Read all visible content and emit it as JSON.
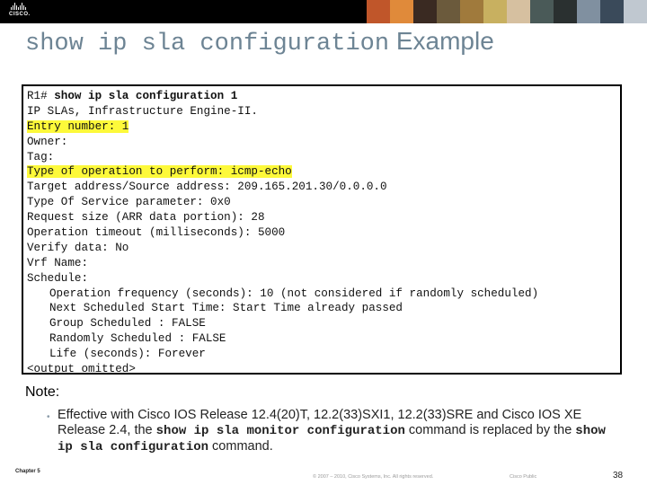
{
  "header": {
    "logo_text": "CISCO.",
    "photo_strip_colors": [
      "#c0562a",
      "#e08a3a",
      "#3a2a22",
      "#6b5a3c",
      "#a07a3c",
      "#c8b060",
      "#d6c0a0",
      "#4a5a58",
      "#2a3030",
      "#8090a0",
      "#3a4a5a",
      "#c0c8d0"
    ]
  },
  "title": {
    "mono_part": "show ip sla configuration",
    "sans_part": " Example",
    "color": "#6d8494"
  },
  "code": {
    "lines": [
      {
        "prompt": "R1# ",
        "cmd": "show ip sla configuration 1",
        "text": "",
        "highlight": false,
        "indent": false
      },
      {
        "prompt": "",
        "cmd": "",
        "text": "IP SLAs, Infrastructure Engine-II.",
        "highlight": false,
        "indent": false
      },
      {
        "prompt": "",
        "cmd": "",
        "text": "Entry number: 1",
        "highlight": true,
        "indent": false
      },
      {
        "prompt": "",
        "cmd": "",
        "text": "Owner:",
        "highlight": false,
        "indent": false
      },
      {
        "prompt": "",
        "cmd": "",
        "text": "Tag:",
        "highlight": false,
        "indent": false
      },
      {
        "prompt": "",
        "cmd": "",
        "text": "Type of operation to perform: icmp-echo",
        "highlight": true,
        "indent": false
      },
      {
        "prompt": "",
        "cmd": "",
        "text": "Target address/Source address: 209.165.201.30/0.0.0.0",
        "highlight": false,
        "indent": false
      },
      {
        "prompt": "",
        "cmd": "",
        "text": "Type Of Service parameter: 0x0",
        "highlight": false,
        "indent": false
      },
      {
        "prompt": "",
        "cmd": "",
        "text": "Request size (ARR data portion): 28",
        "highlight": false,
        "indent": false
      },
      {
        "prompt": "",
        "cmd": "",
        "text": "Operation timeout (milliseconds): 5000",
        "highlight": false,
        "indent": false
      },
      {
        "prompt": "",
        "cmd": "",
        "text": "Verify data: No",
        "highlight": false,
        "indent": false
      },
      {
        "prompt": "",
        "cmd": "",
        "text": "Vrf Name:",
        "highlight": false,
        "indent": false
      },
      {
        "prompt": "",
        "cmd": "",
        "text": "Schedule:",
        "highlight": false,
        "indent": false
      },
      {
        "prompt": "",
        "cmd": "",
        "text": "Operation frequency (seconds): 10 (not considered if randomly scheduled)",
        "highlight": false,
        "indent": true
      },
      {
        "prompt": "",
        "cmd": "",
        "text": "Next Scheduled Start Time: Start Time already passed",
        "highlight": false,
        "indent": true
      },
      {
        "prompt": "",
        "cmd": "",
        "text": "Group Scheduled : FALSE",
        "highlight": false,
        "indent": true
      },
      {
        "prompt": "",
        "cmd": "",
        "text": "Randomly Scheduled : FALSE",
        "highlight": false,
        "indent": true
      },
      {
        "prompt": "",
        "cmd": "",
        "text": "Life (seconds): Forever",
        "highlight": false,
        "indent": true
      },
      {
        "prompt": "",
        "cmd": "",
        "text": "<output omitted>",
        "highlight": false,
        "indent": false
      }
    ],
    "highlight_color": "#fdf93a"
  },
  "note": {
    "label": "Note:",
    "bullet": "•",
    "text_1": "Effective with Cisco IOS Release 12.4(20)T, 12.2(33)SXI1, 12.2(33)SRE and Cisco IOS XE Release 2.4, the ",
    "cmd_1": "show ip sla monitor configuration",
    "text_2": " command is replaced by the ",
    "cmd_2": "show ip sla configuration",
    "text_3": " command."
  },
  "footer": {
    "chapter": "Chapter 5",
    "copyright": "© 2007 – 2010, Cisco Systems, Inc. All rights reserved.",
    "classification": "Cisco Public",
    "page_number": "38"
  }
}
